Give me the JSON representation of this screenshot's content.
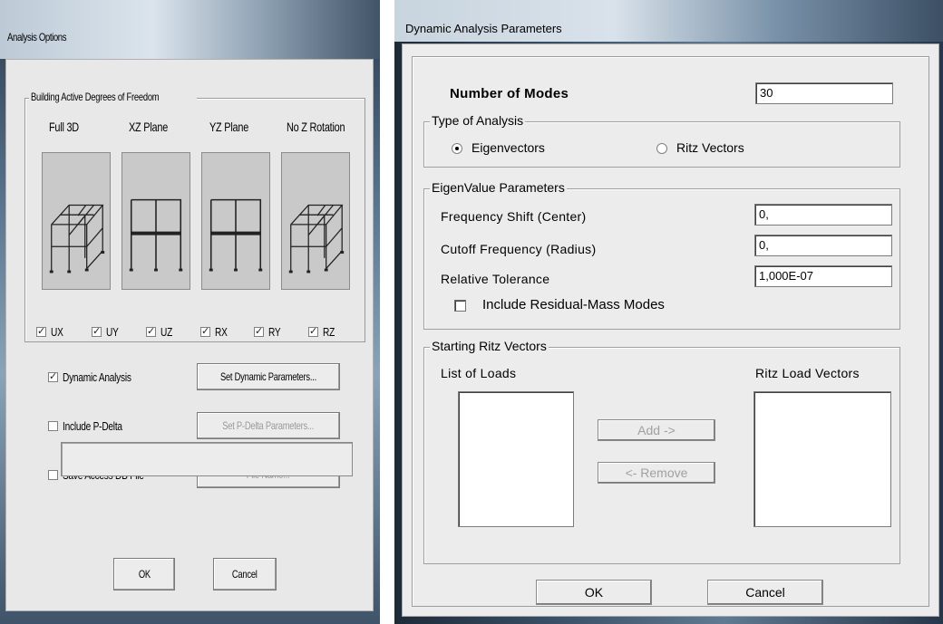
{
  "analysis_options": {
    "title": "Analysis Options",
    "dof_group_label": "Building Active Degrees of Freedom",
    "planes": [
      {
        "label": "Full 3D",
        "icon": "full-3d-frame-icon"
      },
      {
        "label": "XZ Plane",
        "icon": "xz-plane-frame-icon"
      },
      {
        "label": "YZ Plane",
        "icon": "yz-plane-frame-icon"
      },
      {
        "label": "No Z Rotation",
        "icon": "no-z-rotation-frame-icon"
      }
    ],
    "dof_checkboxes": [
      {
        "label": "UX",
        "checked": true
      },
      {
        "label": "UY",
        "checked": true
      },
      {
        "label": "UZ",
        "checked": true
      },
      {
        "label": "RX",
        "checked": true
      },
      {
        "label": "RY",
        "checked": true
      },
      {
        "label": "RZ",
        "checked": true
      }
    ],
    "dynamic_analysis": {
      "label": "Dynamic Analysis",
      "checked": true,
      "button": "Set Dynamic Parameters..."
    },
    "p_delta": {
      "label": "Include P-Delta",
      "checked": false,
      "button": "Set P-Delta Parameters..."
    },
    "save_access": {
      "label": "Save Access DB File",
      "checked": false,
      "button": "File Name..."
    },
    "ok": "OK",
    "cancel": "Cancel"
  },
  "dynamic_params": {
    "title": "Dynamic Analysis Parameters",
    "num_modes_label": "Number of Modes",
    "num_modes_value": "30",
    "type_group_label": "Type of Analysis",
    "eigen_label": "Eigenvectors",
    "ritz_label": "Ritz Vectors",
    "selected_type": "Eigenvectors",
    "eigen_group_label": "EigenValue Parameters",
    "freq_shift_label": "Frequency Shift  (Center)",
    "freq_shift_value": "0,",
    "cutoff_label": "Cutoff Frequency  (Radius)",
    "cutoff_value": "0,",
    "tolerance_label": "Relative Tolerance",
    "tolerance_value": "1,000E-07",
    "residual_label": "Include Residual-Mass Modes",
    "residual_checked": false,
    "ritz_group_label": "Starting Ritz Vectors",
    "list_loads_label": "List of Loads",
    "ritz_load_vectors_label": "Ritz Load Vectors",
    "add_button": "Add ->",
    "remove_button": "<- Remove",
    "ok": "OK",
    "cancel": "Cancel"
  }
}
